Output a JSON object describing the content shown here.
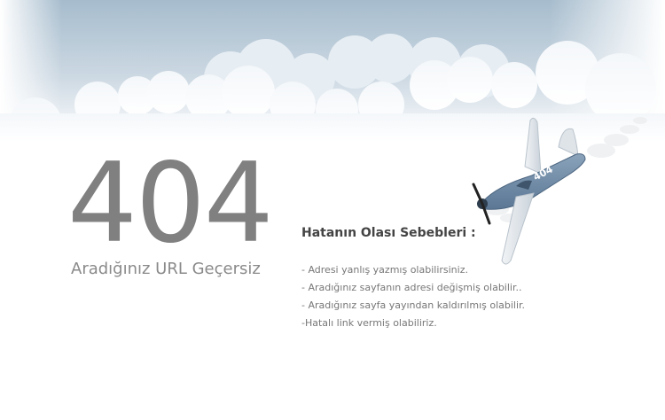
{
  "error": {
    "code": "404",
    "message": "Aradığınız URL Geçersiz"
  },
  "reasons": {
    "title": "Hatanın Olası Sebebleri :",
    "items": [
      "- Adresi yanlış yazmış olabilirsiniz.",
      "- Aradığınız sayfanın adresi değişmiş olabilir..",
      "- Aradığınız sayfa yayından kaldırılmış olabilir.",
      "-Hatalı link vermiş olabiliriz."
    ]
  },
  "illustration": {
    "plane_label": "404",
    "icons": [
      "cloud-icon",
      "airplane-icon"
    ]
  },
  "colors": {
    "sky_top": "#a9bfcf",
    "error_text": "#808080",
    "title_text": "#444444",
    "list_text": "#777777",
    "plane_body": "#6f8aa6"
  }
}
